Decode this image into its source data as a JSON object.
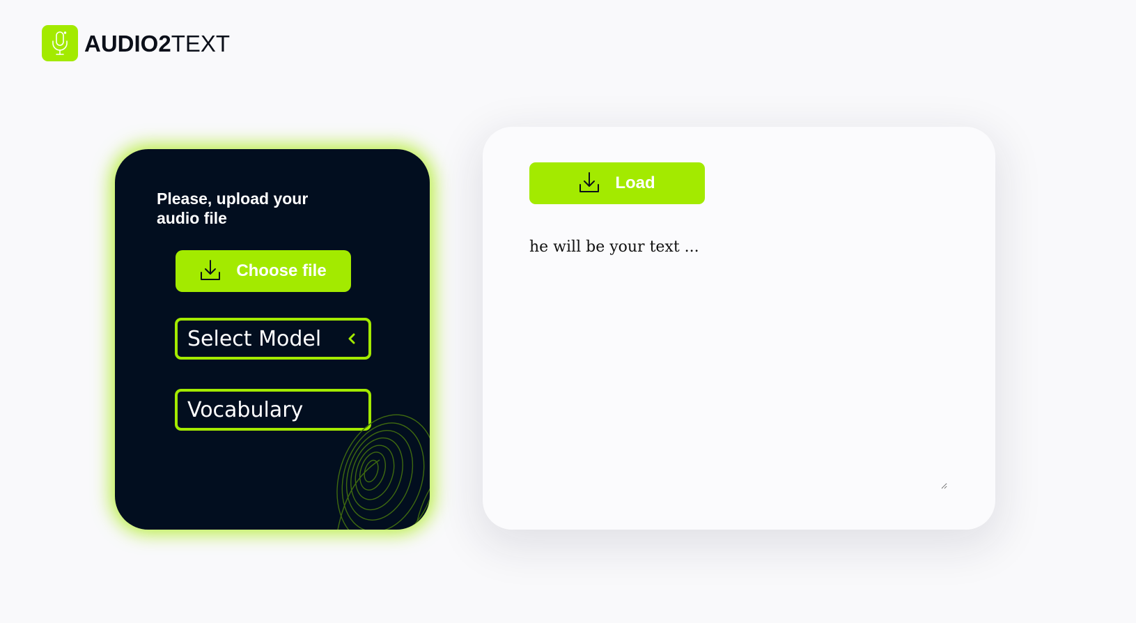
{
  "brand": {
    "name_bold": "AUDIO2",
    "name_light": "TEXT",
    "accent_color": "#a3ea00",
    "logo_icon": "microphone-icon"
  },
  "upload_panel": {
    "title": "Please, upload your audio file",
    "choose_button": {
      "label": "Choose file",
      "icon": "download-icon"
    },
    "model_select": {
      "value": "Select Model",
      "icon": "chevron-left-icon"
    },
    "vocabulary": {
      "value": "Vocabulary"
    },
    "decoration_icon": "fingerprint-icon",
    "background_color": "#020e1f"
  },
  "result_panel": {
    "load_button": {
      "label": "Load",
      "icon": "download-icon"
    },
    "text_placeholder": "he will be your text ..."
  }
}
